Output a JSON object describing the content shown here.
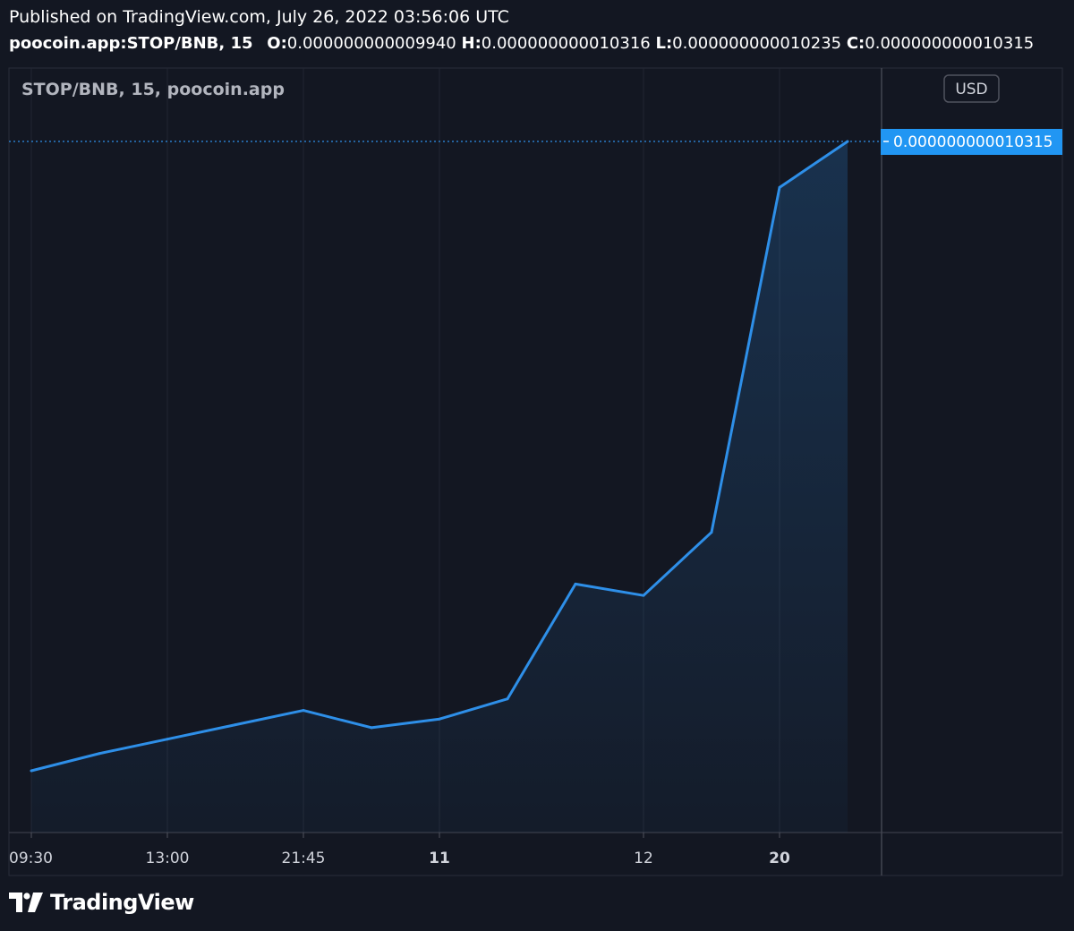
{
  "header": {
    "published": "Published on TradingView.com, July 26, 2022 03:56:06 UTC",
    "symbol": "poocoin.app:STOP/BNB, 15",
    "open_label": "O:",
    "open_value": "0.000000000009940",
    "high_label": "H:",
    "high_value": "0.000000000010316",
    "low_label": "L:",
    "low_value": "0.000000000010235",
    "close_label": "C:",
    "close_value": "0.000000000010315"
  },
  "chart_data": {
    "type": "area",
    "title": "STOP/BNB, 15, poocoin.app",
    "currency_button": "USD",
    "last_price_label": "0.000000000010315",
    "x_tick_labels": [
      "09:30",
      "13:00",
      "21:45",
      "11",
      "12",
      "20"
    ],
    "x_tick_bold": [
      false,
      false,
      false,
      true,
      false,
      true
    ],
    "x_tick_index": [
      0,
      2,
      4,
      6,
      9,
      11
    ],
    "series": [
      {
        "values": [
          0.21,
          0.27,
          0.32,
          0.37,
          0.42,
          0.36,
          0.39,
          0.46,
          0.86,
          0.82,
          1.04,
          2.24,
          2.4
        ]
      }
    ],
    "y_note": "values are relative price levels (no y-axis tick labels shown)",
    "ylim": [
      0,
      2.4
    ],
    "grid": "vertical",
    "colors": {
      "background": "#131722",
      "line": "#2e8fe8",
      "price_tag": "#2196f3",
      "grid": "#222632"
    }
  },
  "branding": {
    "logo_text": "TradingView"
  }
}
